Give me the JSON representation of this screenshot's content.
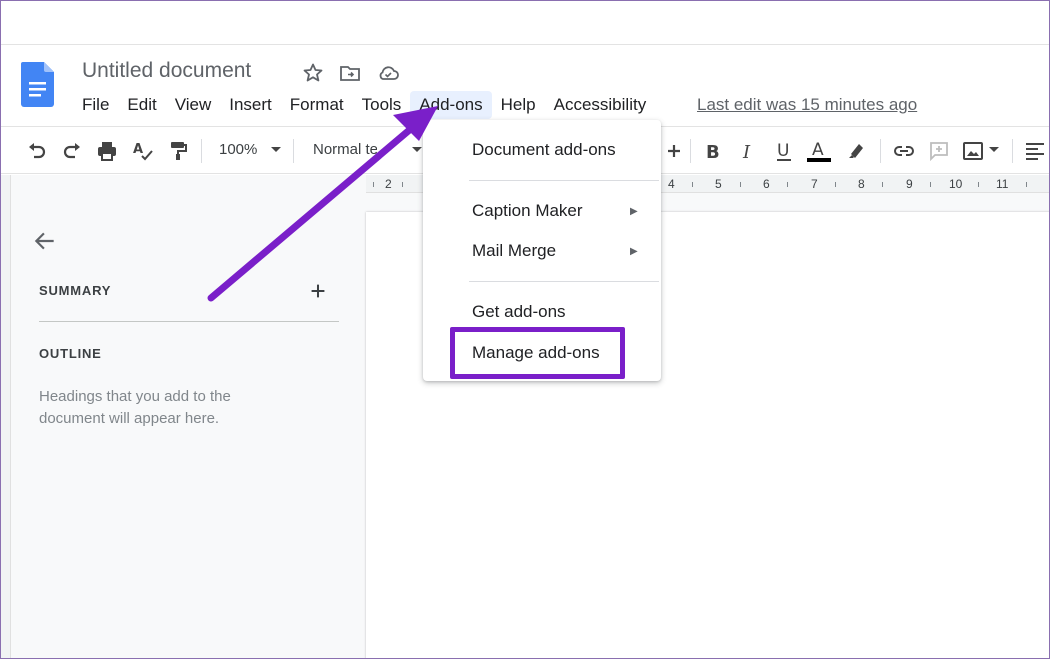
{
  "document": {
    "title": "Untitled document",
    "last_edit": "Last edit was 15 minutes ago"
  },
  "menubar": {
    "items": [
      "File",
      "Edit",
      "View",
      "Insert",
      "Format",
      "Tools",
      "Add-ons",
      "Help",
      "Accessibility"
    ],
    "active": "Add-ons"
  },
  "toolbar": {
    "zoom": "100%",
    "style": "Normal text"
  },
  "ruler": {
    "labels": [
      "2",
      "4",
      "5",
      "6",
      "7",
      "8",
      "9",
      "10",
      "11"
    ]
  },
  "outline_panel": {
    "summary_label": "SUMMARY",
    "outline_label": "OUTLINE",
    "hint": "Headings that you add to the document will appear here."
  },
  "addons_menu": {
    "document_addons": "Document add-ons",
    "caption_maker": "Caption Maker",
    "mail_merge": "Mail Merge",
    "get_addons": "Get add-ons",
    "manage_addons": "Manage add-ons"
  },
  "colors": {
    "docs_blue": "#4285f4",
    "annotation_purple": "#7a1fc9",
    "menu_active_bg": "#e8f0fe"
  }
}
